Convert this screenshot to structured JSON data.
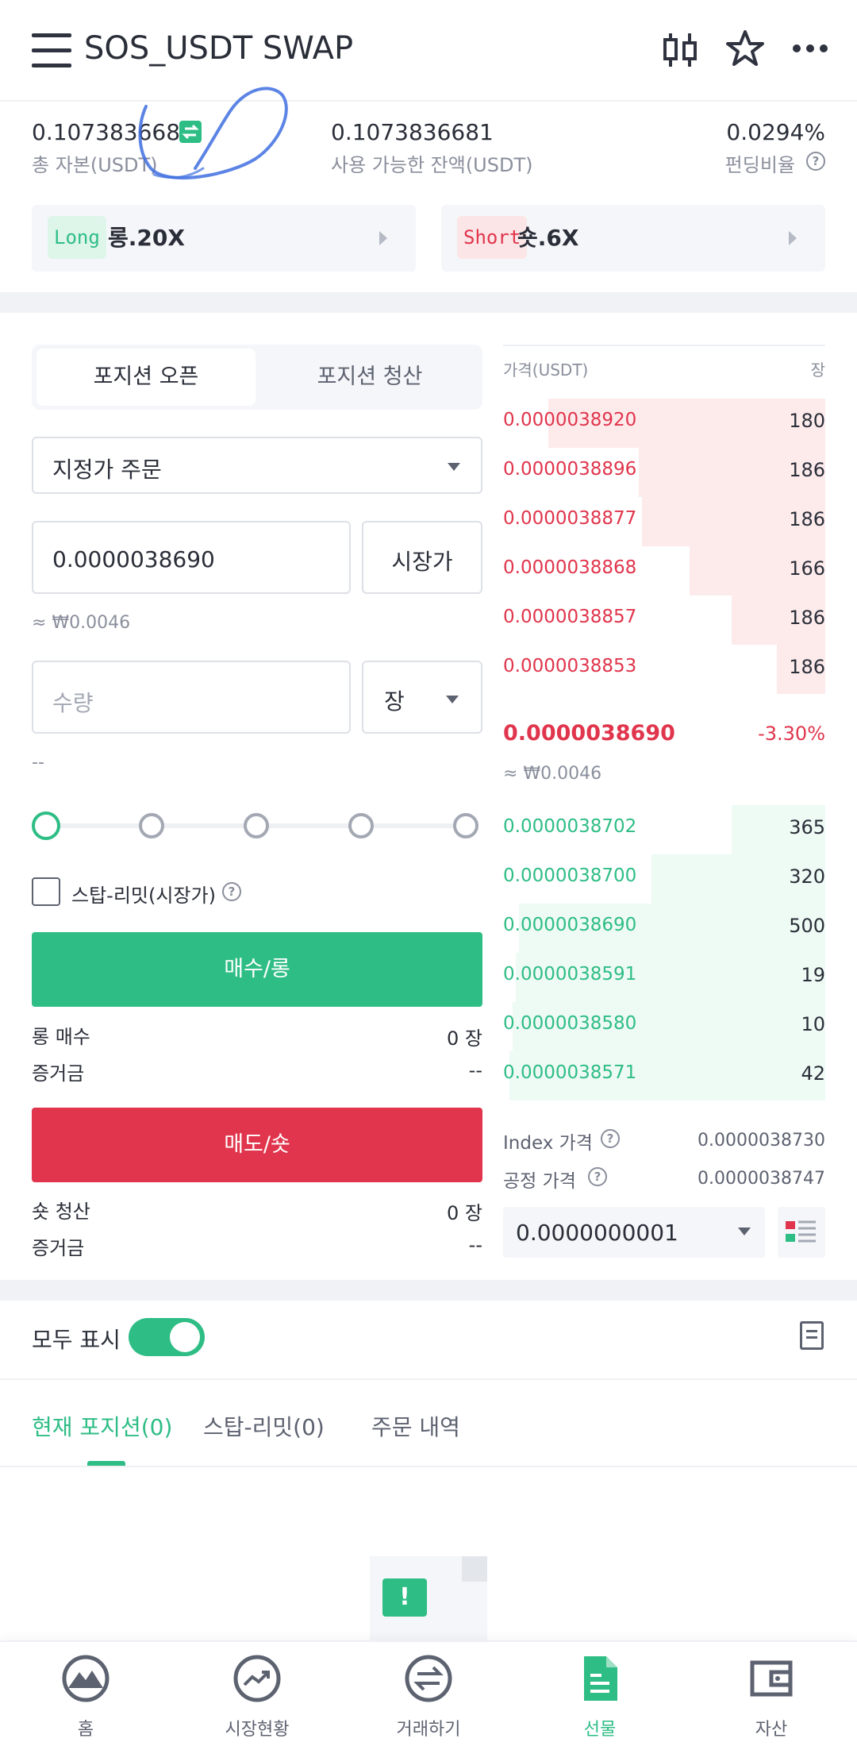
{
  "header": {
    "title": "SOS_USDT SWAP"
  },
  "summary": {
    "total_equity_value": "0.1073836681",
    "total_equity_label": "총 자본(USDT)",
    "available_value": "0.1073836681",
    "available_label": "사용 가능한 잔액(USDT)",
    "funding_value": "0.0294%",
    "funding_label": "펀딩비율"
  },
  "leverage": {
    "long_tag": "Long",
    "long_text": "롱.20X",
    "short_tag": "Short",
    "short_text": "숏.6X"
  },
  "order_form": {
    "tab_open": "포지션 오픈",
    "tab_close": "포지션 청산",
    "order_type": "지정가 주문",
    "price_value": "0.0000038690",
    "market_button": "시장가",
    "price_krw": "≈ ₩0.0046",
    "quantity_placeholder": "수량",
    "unit": "장",
    "quantity_hint": "--",
    "slider_level_percent": 0,
    "stop_limit_label": "스탑-리밋(시장가)",
    "buy_button": "매수/롱",
    "long_buy_label": "롱 매수",
    "long_buy_value": "0 장",
    "margin_label_1": "증거금",
    "margin_value_1": "--",
    "sell_button": "매도/숏",
    "short_close_label": "숏 청산",
    "short_close_value": "0 장",
    "margin_label_2": "증거금",
    "margin_value_2": "--"
  },
  "order_book": {
    "price_header": "가격(USDT)",
    "qty_header": "장",
    "asks": [
      {
        "price": "0.0000038920",
        "qty": "180",
        "depth": 0.86
      },
      {
        "price": "0.0000038896",
        "qty": "186",
        "depth": 0.58
      },
      {
        "price": "0.0000038877",
        "qty": "186",
        "depth": 0.57
      },
      {
        "price": "0.0000038868",
        "qty": "166",
        "depth": 0.42
      },
      {
        "price": "0.0000038857",
        "qty": "186",
        "depth": 0.29
      },
      {
        "price": "0.0000038853",
        "qty": "186",
        "depth": 0.15
      }
    ],
    "last_price": "0.0000038690",
    "last_change": "-3.30%",
    "last_krw": "≈ ₩0.0046",
    "bids": [
      {
        "price": "0.0000038702",
        "qty": "365",
        "depth": 0.29
      },
      {
        "price": "0.0000038700",
        "qty": "320",
        "depth": 0.54
      },
      {
        "price": "0.0000038690",
        "qty": "500",
        "depth": 0.95
      },
      {
        "price": "0.0000038591",
        "qty": "19",
        "depth": 0.96
      },
      {
        "price": "0.0000038580",
        "qty": "10",
        "depth": 0.97
      },
      {
        "price": "0.0000038571",
        "qty": "42",
        "depth": 0.98
      }
    ],
    "index_label": "Index 가격",
    "index_value": "0.0000038730",
    "fair_label": "공정 가격",
    "fair_value": "0.0000038747",
    "precision": "0.0000000001"
  },
  "positions": {
    "show_all_label": "모두 표시",
    "tab_current": "현재 포지션(0)",
    "tab_stop_limit": "스탑-리밋(0)",
    "tab_history": "주문 내역"
  },
  "bottom_nav": [
    {
      "label": "홈",
      "icon": "home-mountain-icon"
    },
    {
      "label": "시장현황",
      "icon": "market-trend-icon"
    },
    {
      "label": "거래하기",
      "icon": "exchange-icon"
    },
    {
      "label": "선물",
      "icon": "futures-doc-icon"
    },
    {
      "label": "자산",
      "icon": "wallet-icon"
    }
  ],
  "colors": {
    "green": "#2ebd85",
    "red": "#e0354c",
    "annotation_blue": "#3f6fe0"
  }
}
